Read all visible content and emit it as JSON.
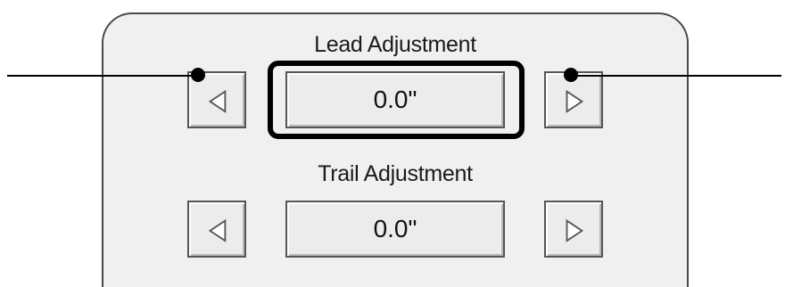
{
  "lead": {
    "label": "Lead Adjustment",
    "value": "0.0\"",
    "decrease_icon": "left-triangle-icon",
    "increase_icon": "right-triangle-icon"
  },
  "trail": {
    "label": "Trail Adjustment",
    "value": "0.0\"",
    "decrease_icon": "left-triangle-icon",
    "increase_icon": "right-triangle-icon"
  },
  "colors": {
    "panel_background": "#f0f0f0",
    "button_face": "#ececec",
    "highlight_outline": "#000000",
    "callout": "#000000"
  }
}
